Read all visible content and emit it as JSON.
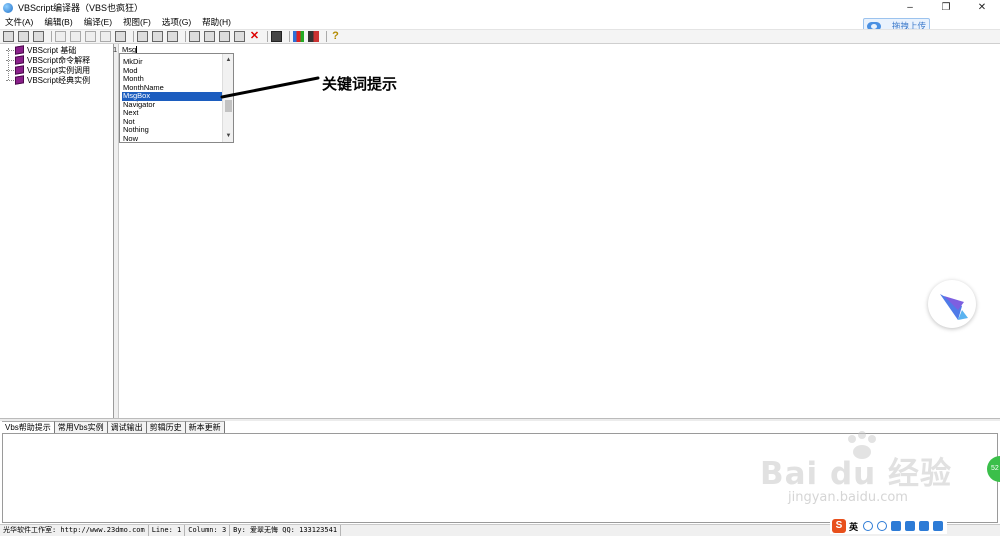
{
  "window": {
    "title": "VBScript编译器（VBS也疯狂）",
    "minimize": "–",
    "restore": "❐",
    "close": "✕"
  },
  "menu": [
    "文件(A)",
    "编辑(B)",
    "编译(E)",
    "视图(F)",
    "选项(G)",
    "帮助(H)"
  ],
  "upload_button": "拖拽上传",
  "tree": {
    "items": [
      "VBScript 基础",
      "VBScript命令解释",
      "VBScript实例调用",
      "VBScript经典实例"
    ]
  },
  "editor": {
    "line_number": "1",
    "code": "Msg"
  },
  "autocomplete": {
    "items": [
      "MkDir",
      "Mod",
      "Month",
      "MonthName",
      "MsgBox",
      "Navigator",
      "Next",
      "Not",
      "Nothing",
      "Now"
    ],
    "selected_index": 4,
    "scroll_up": "▲",
    "scroll_down": "▼"
  },
  "annotation": "关键词提示",
  "bottom_tabs": [
    "Vbs帮助提示",
    "常用Vbs实例",
    "调试输出",
    "剪辑历史",
    "新本更新"
  ],
  "status": {
    "studio": "光华软件工作室: http://www.23dmo.com",
    "line": "Line: 1",
    "column": "Column: 3",
    "author": "By: 爱翠无悔 QQ: 133123541"
  },
  "ime": {
    "logo": "S",
    "lang": "英"
  },
  "watermark": {
    "brand": "Bai du 经验",
    "url": "jingyan.baidu.com"
  },
  "badge": "52"
}
